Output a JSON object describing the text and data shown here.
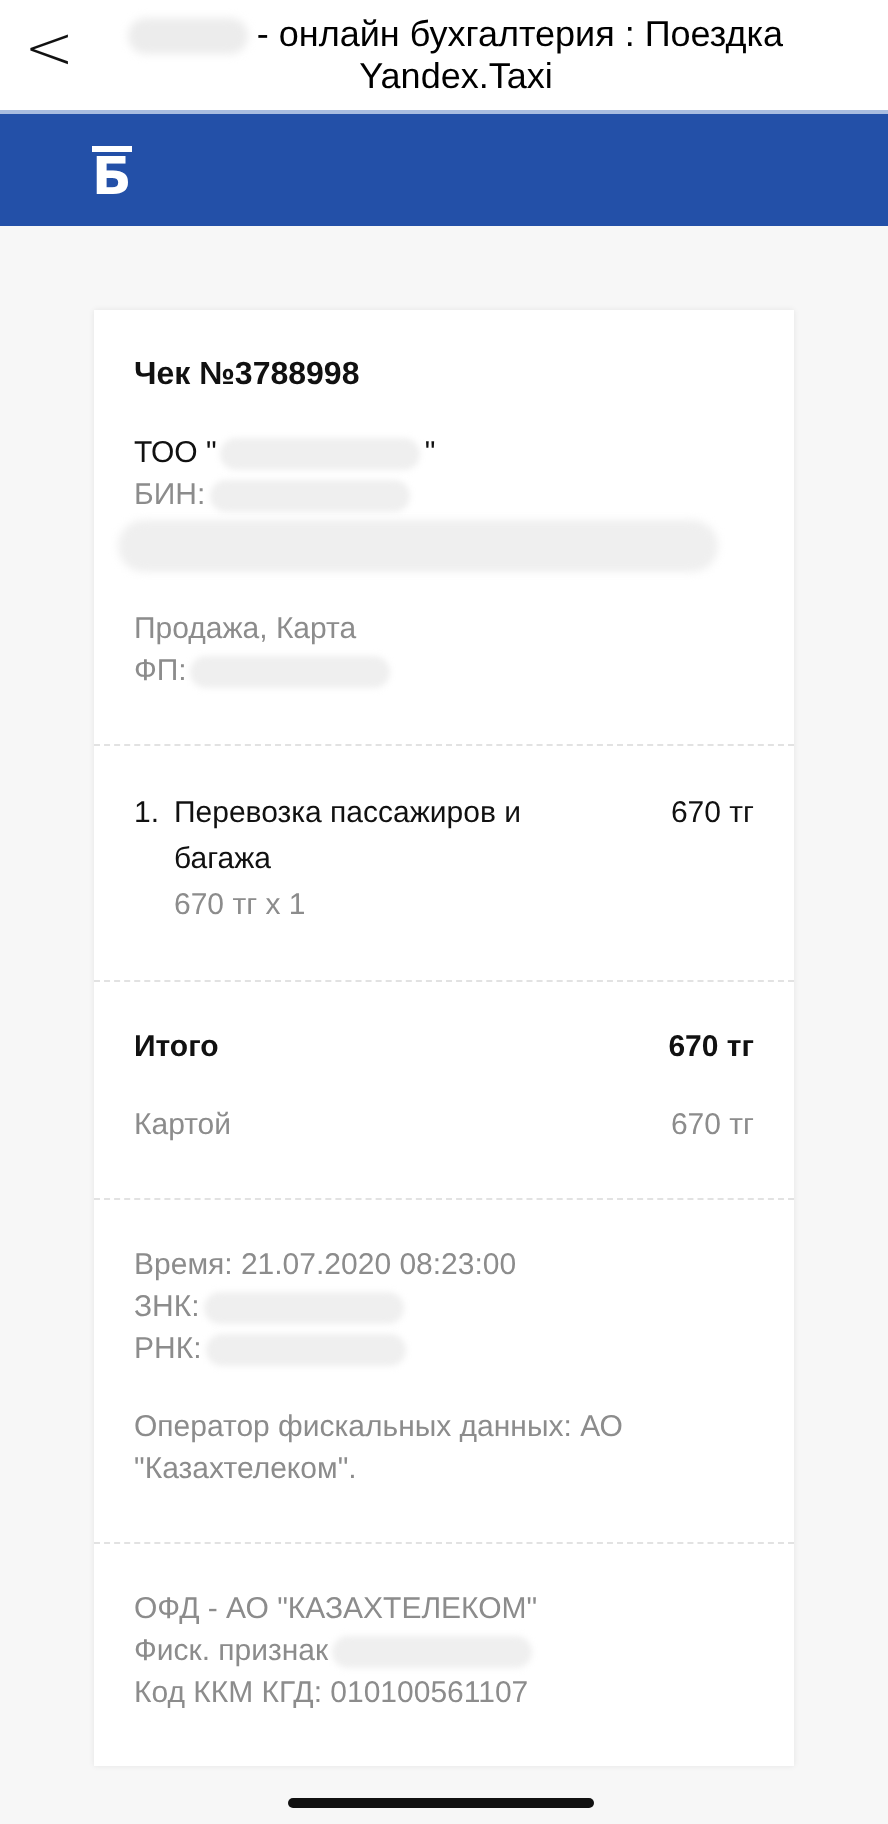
{
  "header": {
    "back": "<",
    "title": "- онлайн бухгалтерия : Поездка Yandex.Taxi",
    "title_redacted": true
  },
  "brand": {
    "logo": "Б"
  },
  "receipt": {
    "sections": [
      [
        [
          {
            "kind": "heading",
            "text": "Чек №3788998"
          }
        ],
        [
          {
            "kind": "text",
            "text": "ТОО \"",
            "redacted": true,
            "after": "\""
          },
          {
            "kind": "note",
            "text": "БИН:",
            "redacted": true
          },
          {
            "kind": "blot"
          }
        ],
        [
          {
            "kind": "note",
            "text": "Продажа, Карта"
          },
          {
            "kind": "note",
            "text": "ФП:",
            "redacted": true
          }
        ]
      ],
      [
        [
          {
            "kind": "item",
            "number": "1.",
            "name": "Перевозка пассажиров и багажа",
            "price": "670 тг",
            "detail": "670 тг x 1"
          }
        ]
      ],
      [
        [
          {
            "kind": "total",
            "label": "Итого",
            "amount": "670 тг"
          }
        ],
        [
          {
            "kind": "payment",
            "label": "Картой",
            "amount": "670 тг"
          }
        ]
      ],
      [
        [
          {
            "kind": "note",
            "text": "Время: 21.07.2020 08:23:00"
          },
          {
            "kind": "note",
            "text": "ЗНК:",
            "redacted": true
          },
          {
            "kind": "note",
            "text": "РНК:",
            "redacted": true
          }
        ],
        [
          {
            "kind": "note",
            "text": "Оператор фискальных данных: АО \"Казахтелеком\"."
          }
        ]
      ],
      [
        [
          {
            "kind": "note",
            "text": "ОФД - АО \"КАЗАХТЕЛЕКОМ\""
          },
          {
            "kind": "note",
            "text": "Фиск. признак",
            "redacted": true
          },
          {
            "kind": "note",
            "text": "Код ККМ КГД: 010100561107"
          }
        ]
      ]
    ]
  }
}
